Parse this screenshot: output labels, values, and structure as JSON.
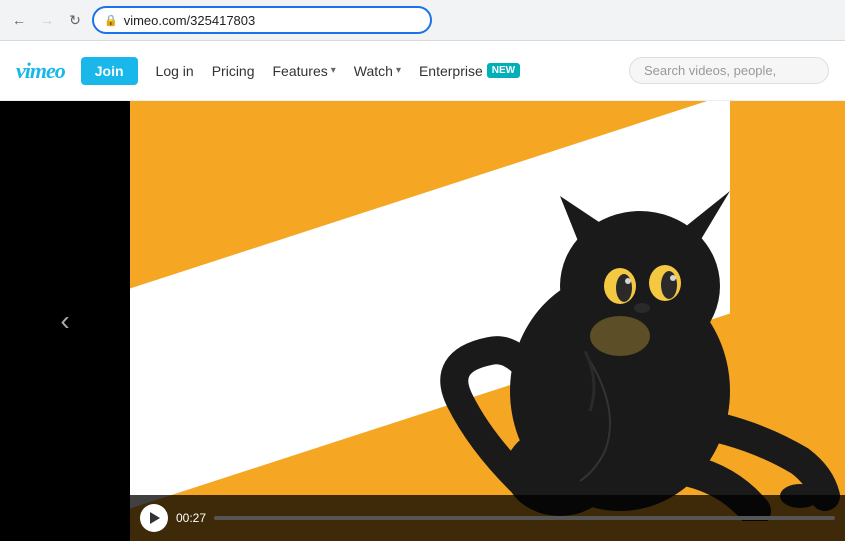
{
  "browser": {
    "url": "vimeo.com/325417803",
    "back_disabled": false,
    "forward_disabled": true
  },
  "nav": {
    "logo": "vimeo",
    "join_label": "Join",
    "login_label": "Log in",
    "pricing_label": "Pricing",
    "features_label": "Features",
    "features_arrow": "▾",
    "watch_label": "Watch",
    "watch_arrow": "▾",
    "enterprise_label": "Enterprise",
    "new_badge": "NEW",
    "search_placeholder": "Search videos, people,"
  },
  "video": {
    "time_current": "00",
    "time_total": "27",
    "time_display": "00:27"
  },
  "controls": {
    "prev_arrow": "‹"
  }
}
